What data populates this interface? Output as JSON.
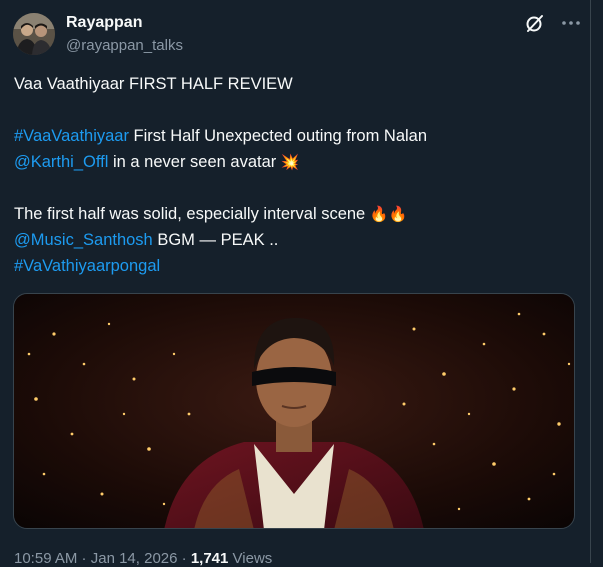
{
  "author": {
    "display_name": "Rayappan",
    "handle": "@rayappan_talks",
    "avatar_icon": "avatar-two-people-photo"
  },
  "actions": {
    "grok_icon": "grok-slash-circle-icon",
    "more_icon": "more-dots-icon"
  },
  "post": {
    "line1": "Vaa Vaathiyaar FIRST HALF REVIEW",
    "line2_hashtag": "#VaaVaathiyaar",
    "line2_rest": " First Half Unexpected outing from Nalan",
    "line3_mention": "@Karthi_Offl",
    "line3_rest": "  in a never seen avatar ",
    "line3_emoji": "💥",
    "line4_text": "The first half was solid, especially interval scene ",
    "line4_emoji": "🔥🔥",
    "line5_mention": "@Music_Santhosh",
    "line5_rest": " BGM — PEAK ..",
    "line6_hashtag": "#VaVathiyaarpongal"
  },
  "media": {
    "description_icon": "masked-man-photo"
  },
  "footer": {
    "time": "10:59 AM",
    "sep1": " · ",
    "date": "Jan 14, 2026",
    "sep2": " · ",
    "views_count": "1,741",
    "views_label": " Views"
  },
  "colors": {
    "background": "#15202b",
    "link": "#1d9bf0",
    "secondary_text": "#8b98a5",
    "border": "#38444d"
  }
}
